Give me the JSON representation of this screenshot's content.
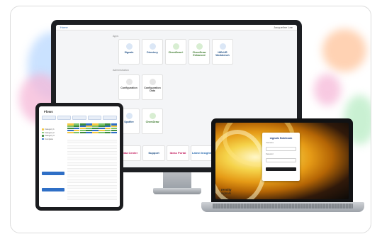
{
  "monitor": {
    "top_left": "Home",
    "top_right": "Jacqueline Lee",
    "section_top": "Apps",
    "section_mid": "Administration",
    "tiles_row1": [
      {
        "title": "Signals",
        "color": "#2b6cb0"
      },
      {
        "title": "Directory",
        "color": "#2b6cb0"
      },
      {
        "title": "ChemDraw+",
        "color": "#3c7a2c"
      },
      {
        "title": "ChemDraw Enhanced",
        "color": "#3c7a2c"
      },
      {
        "title": "HiExUR Workbench",
        "color": "#2b6cb0"
      }
    ],
    "tiles_row2": [
      {
        "title": "Configuration",
        "color": "#666666"
      },
      {
        "title": "Configuration Data",
        "color": "#666666"
      }
    ],
    "tiles_row3": [
      {
        "title": "Spotfire",
        "color": "#2b6cb0"
      },
      {
        "title": "ChemDraw",
        "color": "#3c7a2c"
      }
    ],
    "bottom_tiles": [
      {
        "label": "Data Center",
        "color": "#c2185b"
      },
      {
        "label": "Support",
        "color": "#1f4f85"
      },
      {
        "label": "Ideas Portal",
        "color": "#c2185b"
      },
      {
        "label": "Latest Insights",
        "color": "#2b6cb0"
      }
    ]
  },
  "tablet": {
    "title": "Flows",
    "grid_colors": [
      "#f5c842",
      "#7cc46a",
      "#3d8b3d",
      "#2f6fc6"
    ],
    "legend": [
      {
        "label": "Category 1",
        "color": "#f5c842"
      },
      {
        "label": "Category 2",
        "color": "#7cc46a"
      },
      {
        "label": "Category 3",
        "color": "#3d8b3d"
      },
      {
        "label": "Complete",
        "color": "#2f6fc6"
      }
    ]
  },
  "laptop": {
    "app_title": "signals Notebook",
    "login_field_1": "Username",
    "login_field_2": "Password",
    "brand_line_1": "revvity",
    "brand_line_2": "signals"
  },
  "colors": {
    "blob_pink": "#f6b8d8",
    "blob_blue": "#b9d8ff",
    "blob_orange": "#ffc39a",
    "blob_green": "#b8ecc4"
  }
}
